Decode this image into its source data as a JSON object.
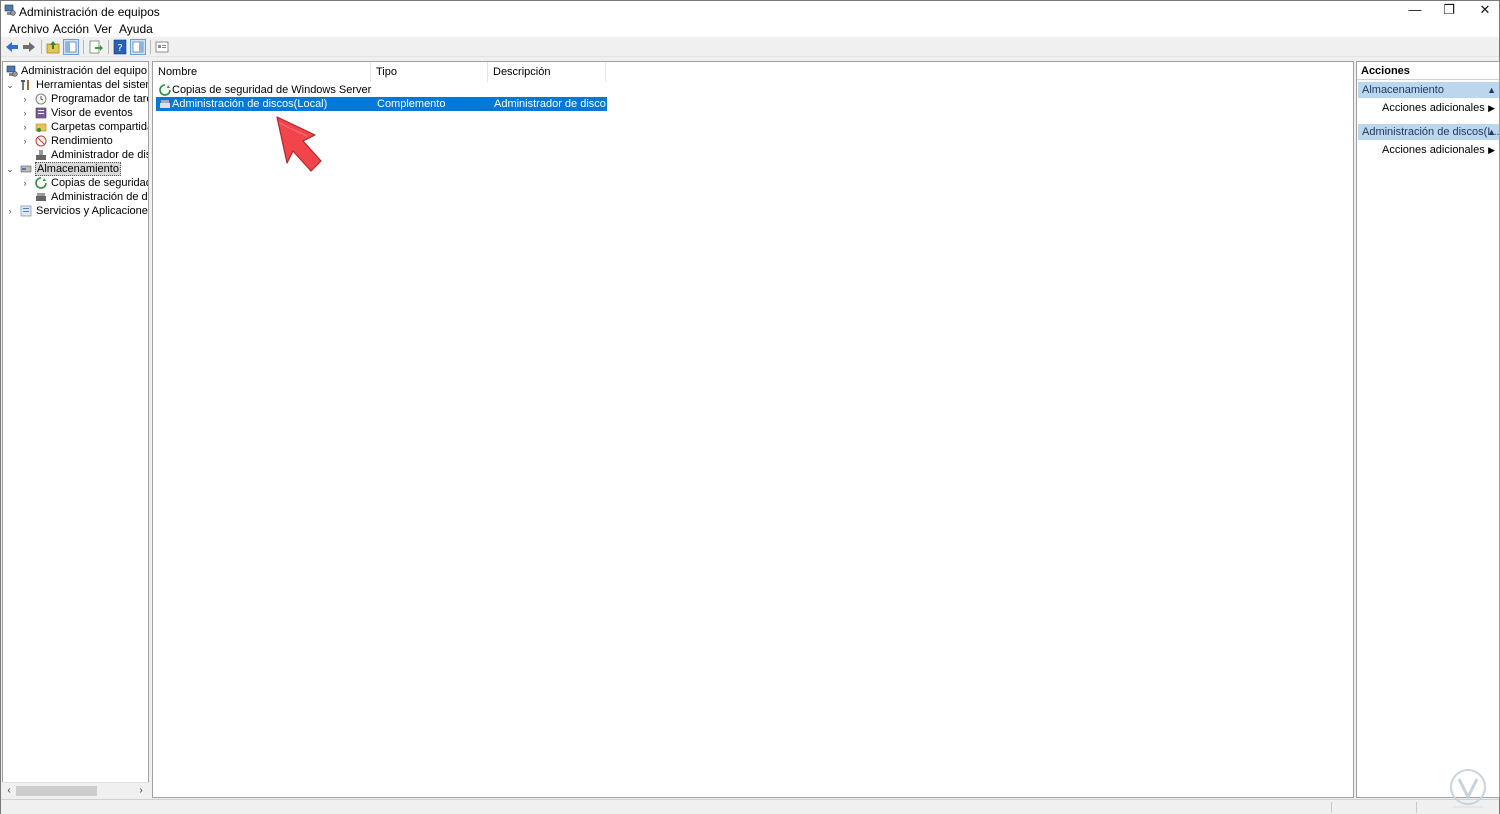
{
  "window": {
    "title": "Administración de equipos",
    "controls": {
      "minimize": "—",
      "maximize": "❐",
      "close": "✕"
    }
  },
  "menu": [
    "Archivo",
    "Acción",
    "Ver",
    "Ayuda"
  ],
  "toolbar": {
    "buttons": [
      "back-icon",
      "forward-icon",
      "up-folder-icon",
      "show-hide-tree-icon",
      "export-list-icon",
      "help-icon",
      "show-hide-action-pane-icon",
      "properties-icon"
    ]
  },
  "tree": {
    "root": "Administración del equipo (loc",
    "system_tools": "Herramientas del sistema",
    "task_scheduler": "Programador de tareas",
    "event_viewer": "Visor de eventos",
    "shared_folders": "Carpetas compartidas",
    "performance": "Rendimiento",
    "device_manager": "Administrador de dispo",
    "storage": "Almacenamiento",
    "backup": "Copias de seguridad de",
    "disk_mgmt": "Administración de disco",
    "services_apps": "Servicios y Aplicaciones"
  },
  "list": {
    "columns": {
      "name": "Nombre",
      "type": "Tipo",
      "description": "Descripción"
    },
    "rows": [
      {
        "name": "Copias de seguridad de Windows Server",
        "type": "",
        "description": ""
      },
      {
        "name": "Administración de discos(Local)",
        "type": "Complemento",
        "description": "Administrador de discos..."
      }
    ]
  },
  "actions": {
    "title": "Acciones",
    "sections": [
      {
        "label": "Almacenamiento",
        "item": "Acciones adicionales"
      },
      {
        "label": "Administración de discos(L...",
        "item": "Acciones adicionales"
      }
    ]
  },
  "colors": {
    "selection": "#0078d7",
    "section_header": "#bcd6ee",
    "annotation_arrow": "#f2454b"
  }
}
